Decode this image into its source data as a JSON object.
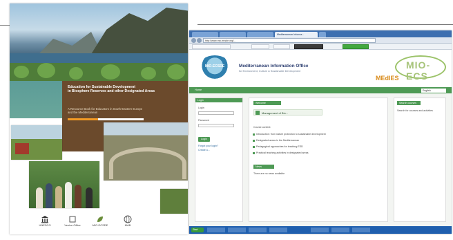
{
  "book": {
    "title_lines": [
      "Education for Sustainable Development",
      "in Biosphere Reserves and other Designated Areas",
      "A Resource Book for Educators in South-Eastern Europe",
      "and the Mediterranean"
    ],
    "logos": [
      "UNESCO",
      "Venice Office",
      "MIO-ECSDE",
      "MAB"
    ]
  },
  "browser": {
    "tabs": [
      "",
      "",
      "",
      "Mediterranean Informa..."
    ],
    "address": "http://www.mio-ecsde.org/...",
    "toolbar": [
      "",
      "",
      "",
      "",
      ""
    ]
  },
  "site": {
    "logo_left": "MIO-ECSDE",
    "title": "Mediterranean Information Office",
    "subtitle": "for Environment, Culture & Sustainable Development",
    "logo_right": "MIO-ECS",
    "medies": "MEdIES",
    "nav": {
      "home": "Home",
      "language": "English"
    },
    "login": {
      "heading": "Login",
      "username": "Login",
      "password": "Password",
      "button": "Login",
      "links": [
        "Forgot your login?",
        "Create a..."
      ]
    },
    "main": {
      "heading": "Welcome",
      "course_title": "Management of Bio...",
      "intro": "Course content:",
      "items": [
        "Introduction: from nature protection to sustainable development",
        "Designated areas in the Mediterranean",
        "Pedagogical approaches for teaching ESD",
        "Practical teaching activities in designated areas"
      ],
      "news_heading": "News",
      "news_text": "There are no news available"
    },
    "right": {
      "heading": "Search courses",
      "text": "Search for courses and activities"
    }
  },
  "taskbar": {
    "start": "Start",
    "items": [
      "",
      "",
      "",
      "",
      "",
      "",
      ""
    ]
  }
}
